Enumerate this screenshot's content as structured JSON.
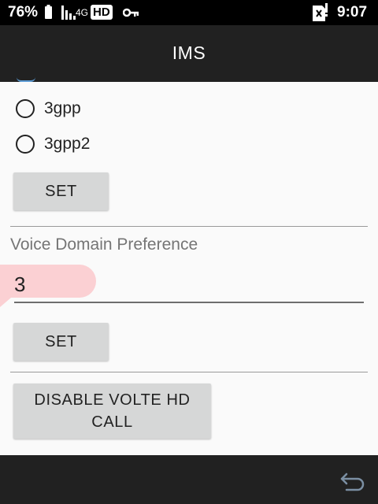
{
  "status_bar": {
    "battery_percent": "76%",
    "network_type": "4G",
    "hd_badge": "HD",
    "time": "9:07",
    "icons": [
      "battery-icon",
      "signal-icon",
      "key-icon",
      "sim-icon"
    ]
  },
  "app_bar": {
    "title": "IMS"
  },
  "sms_format": {
    "options": [
      {
        "label": "3gpp",
        "selected": false
      },
      {
        "label": "3gpp2",
        "selected": false
      }
    ],
    "set_label": "SET"
  },
  "voice_domain": {
    "label": "Voice Domain Preference",
    "value": "3",
    "set_label": "SET"
  },
  "volte": {
    "disable_label": "DISABLE VOLTE HD CALL"
  },
  "navigation": {
    "back_icon": "back-arrow-icon"
  },
  "colors": {
    "app_bar": "#212121",
    "button": "#d6d7d7",
    "highlight": "#fbd0d3",
    "content_bg": "#fafafa"
  }
}
